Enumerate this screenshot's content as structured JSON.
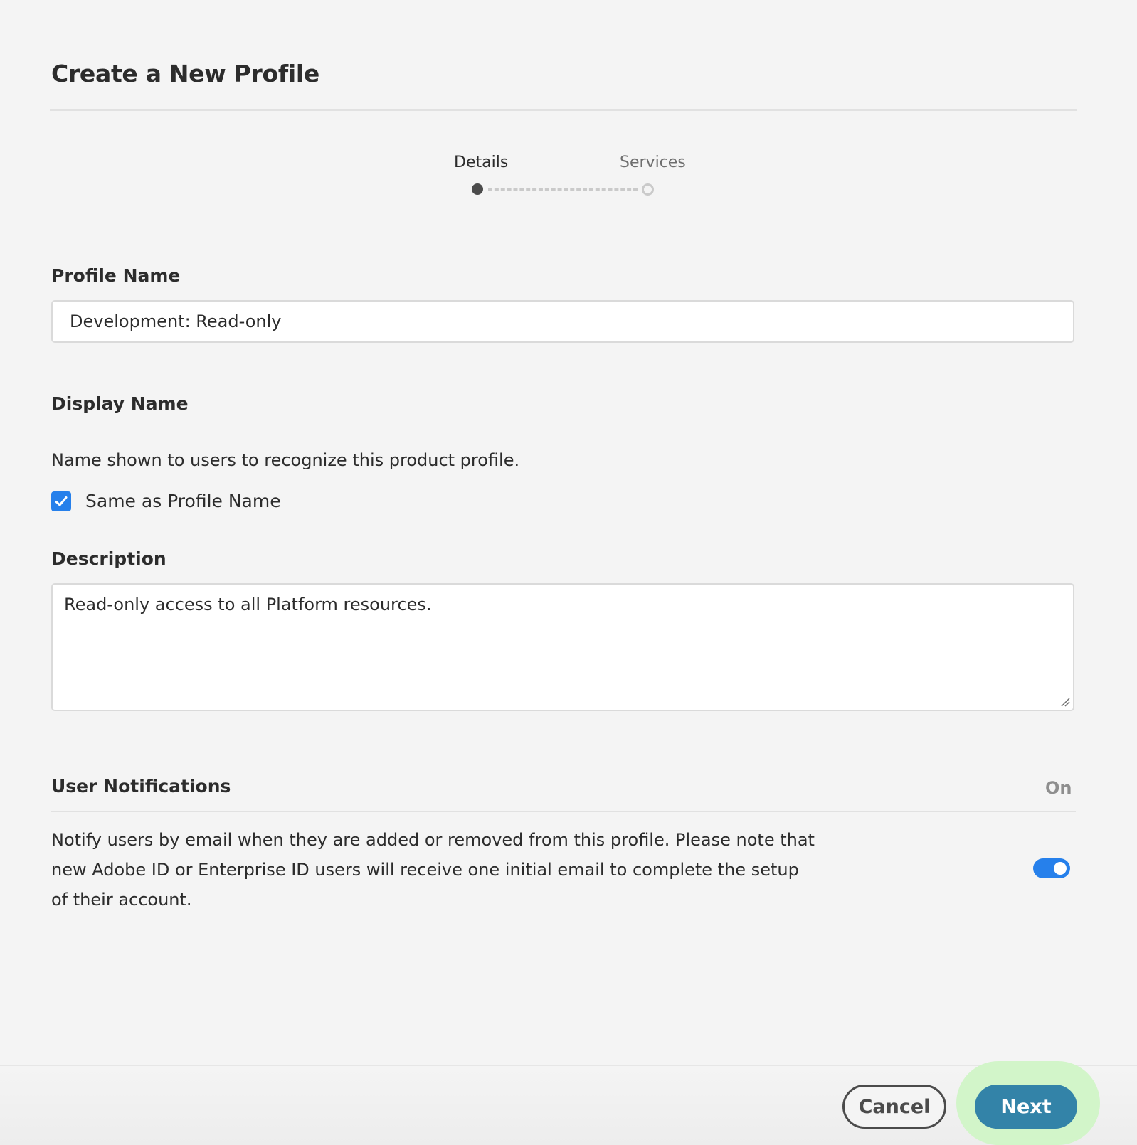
{
  "dialog": {
    "title": "Create a New Profile"
  },
  "stepper": {
    "steps": [
      {
        "label": "Details",
        "state": "active"
      },
      {
        "label": "Services",
        "state": "pending"
      }
    ]
  },
  "profile_name": {
    "label": "Profile Name",
    "value": "Development: Read-only"
  },
  "display_name": {
    "label": "Display Name",
    "help": "Name shown to users to recognize this product profile.",
    "same_as_label": "Same as Profile Name",
    "same_as_checked": true
  },
  "description": {
    "label": "Description",
    "value": "Read-only access to all Platform resources."
  },
  "notifications": {
    "label": "User Notifications",
    "state_text": "On",
    "text": "Notify users by email when they are added or removed from this profile. Please note that new Adobe ID or Enterprise ID users will receive one initial email to complete the setup of their account.",
    "enabled": true
  },
  "footer": {
    "cancel_label": "Cancel",
    "next_label": "Next"
  },
  "colors": {
    "accent": "#2680eb",
    "primary_button": "#3383a8",
    "highlight": "#d2f5c9",
    "background": "#f4f4f4"
  }
}
